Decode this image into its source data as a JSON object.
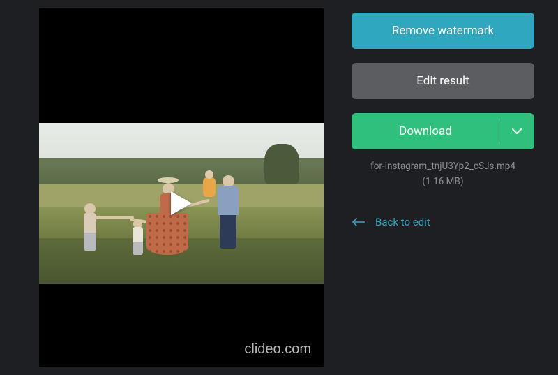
{
  "preview": {
    "watermark_text": "clideo.com"
  },
  "actions": {
    "remove_watermark_label": "Remove watermark",
    "edit_result_label": "Edit result",
    "download_label": "Download"
  },
  "file": {
    "name": "for-instagram_tnjU3Yp2_cSJs.mp4",
    "size_text": "(1.16 MB)"
  },
  "nav": {
    "back_label": "Back to edit"
  }
}
